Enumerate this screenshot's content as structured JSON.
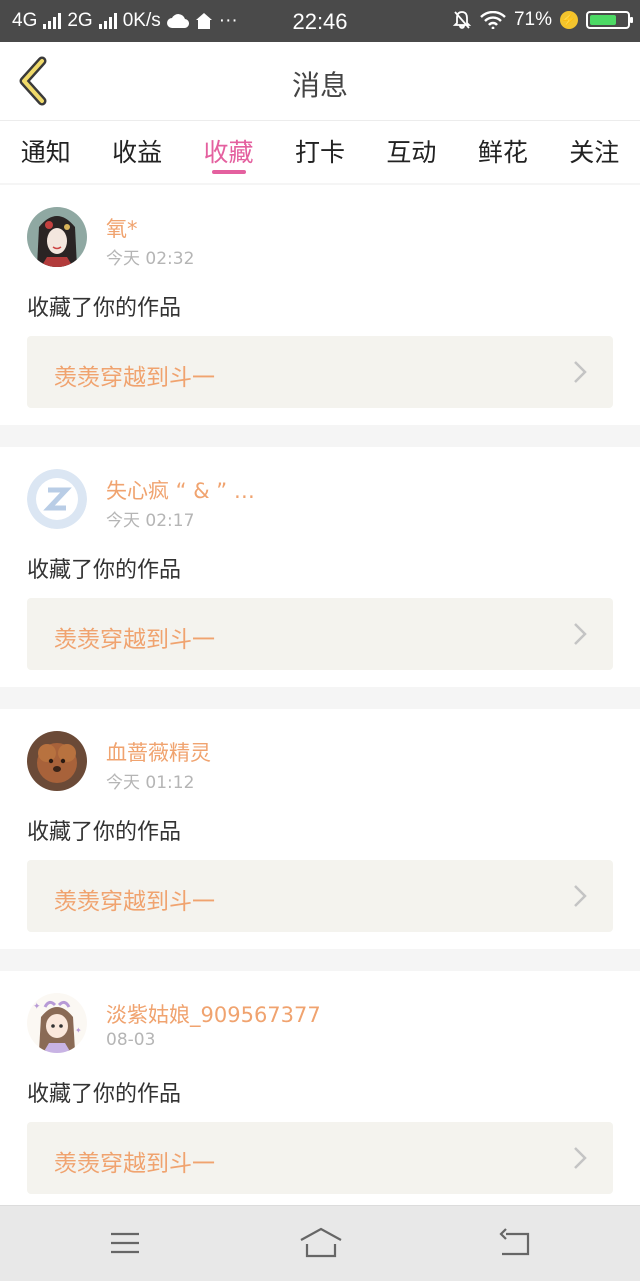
{
  "status_bar": {
    "network_1": "4G",
    "network_2": "2G",
    "speed": "0K/s",
    "time": "22:46",
    "battery": "71%",
    "battery_level": 0.71
  },
  "header": {
    "title": "消息"
  },
  "tabs": [
    {
      "label": "通知",
      "active": false
    },
    {
      "label": "收益",
      "active": false
    },
    {
      "label": "收藏",
      "active": true
    },
    {
      "label": "打卡",
      "active": false
    },
    {
      "label": "互动",
      "active": false
    },
    {
      "label": "鲜花",
      "active": false
    },
    {
      "label": "关注",
      "active": false
    }
  ],
  "messages": [
    {
      "user": "氧*",
      "time": "今天 02:32",
      "action": "收藏了你的作品",
      "work": "羡羡穿越到斗一"
    },
    {
      "user": "失心疯 “ & ” …",
      "time": "今天 02:17",
      "action": "收藏了你的作品",
      "work": "羡羡穿越到斗一"
    },
    {
      "user": "血蔷薇精灵",
      "time": "今天 01:12",
      "action": "收藏了你的作品",
      "work": "羡羡穿越到斗一"
    },
    {
      "user": "淡紫姑娘_909567377",
      "time": "08-03",
      "action": "收藏了你的作品",
      "work": "羡羡穿越到斗一"
    }
  ],
  "colors": {
    "accent": "#e4609f",
    "username": "#f0a36f",
    "work_bg": "#f4f3ee"
  },
  "icons": {
    "back": "back-chevron-icon",
    "menu": "menu-icon",
    "home": "home-icon",
    "return": "return-icon"
  }
}
